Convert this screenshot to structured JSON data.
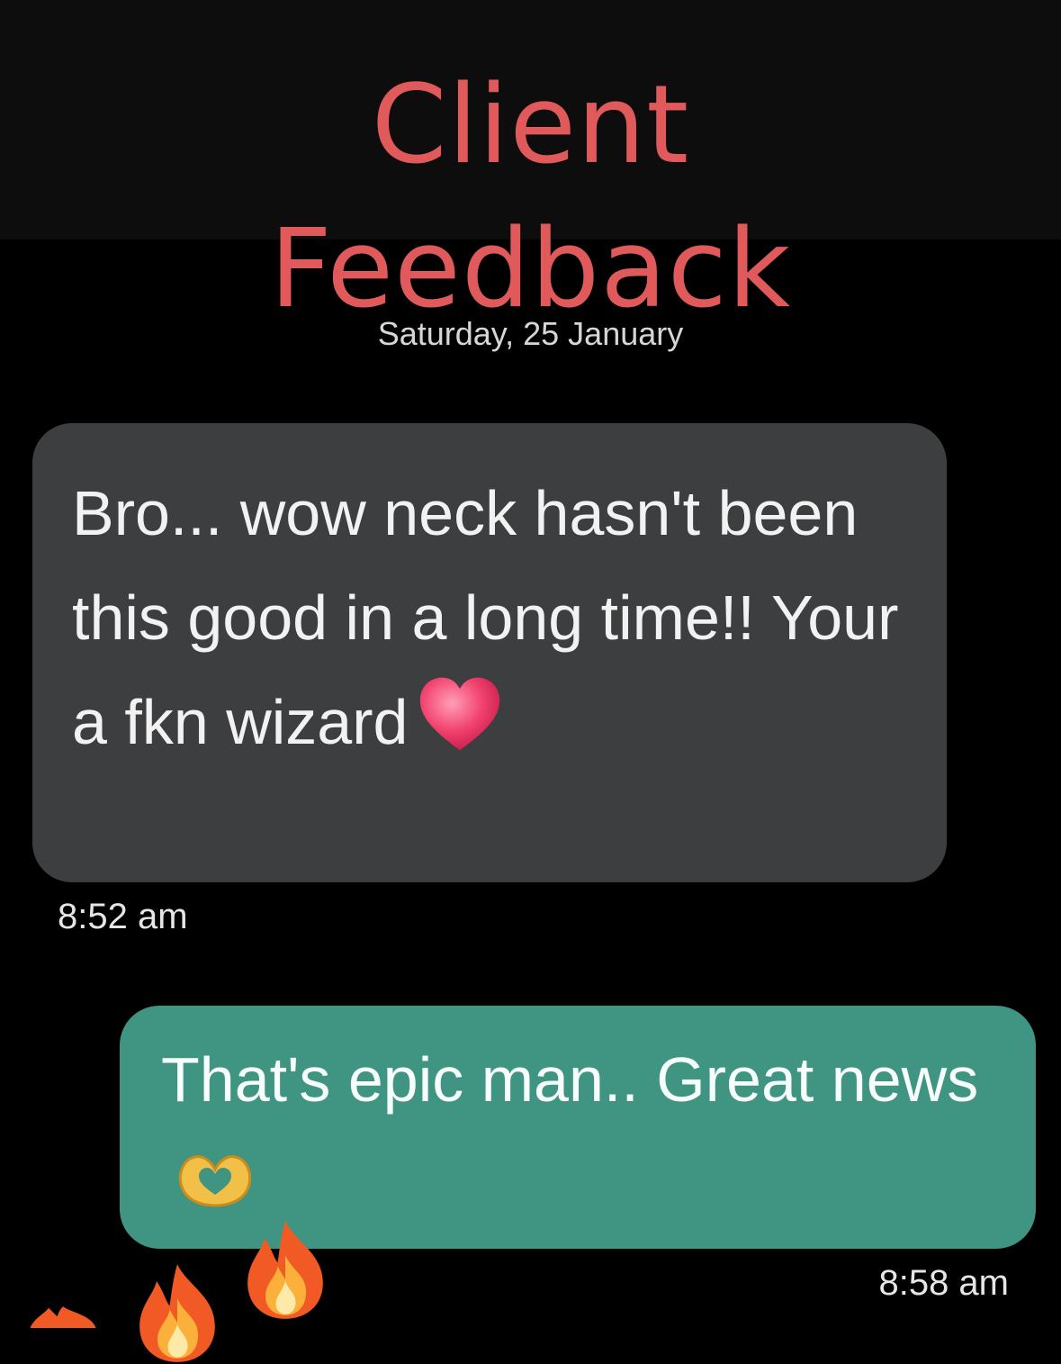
{
  "header": {
    "title_line1": "Client",
    "title_line2": "Feedback",
    "title_color": "#e05a5c"
  },
  "conversation": {
    "date_separator": "Saturday, 25 January",
    "messages": [
      {
        "direction": "incoming",
        "text": "Bro... wow neck hasn't been this good in a long time!! Your a fkn wizard",
        "emoji": "heart-icon",
        "time": "8:52 am",
        "bubble_color": "#3c3e40"
      },
      {
        "direction": "outgoing",
        "text": "That's epic man.. Great news",
        "emoji": "heart-hands-icon",
        "time": "8:58 am",
        "bubble_color": "#3f9482"
      }
    ]
  },
  "decorations": {
    "reaction_icon": "fire-icon"
  }
}
